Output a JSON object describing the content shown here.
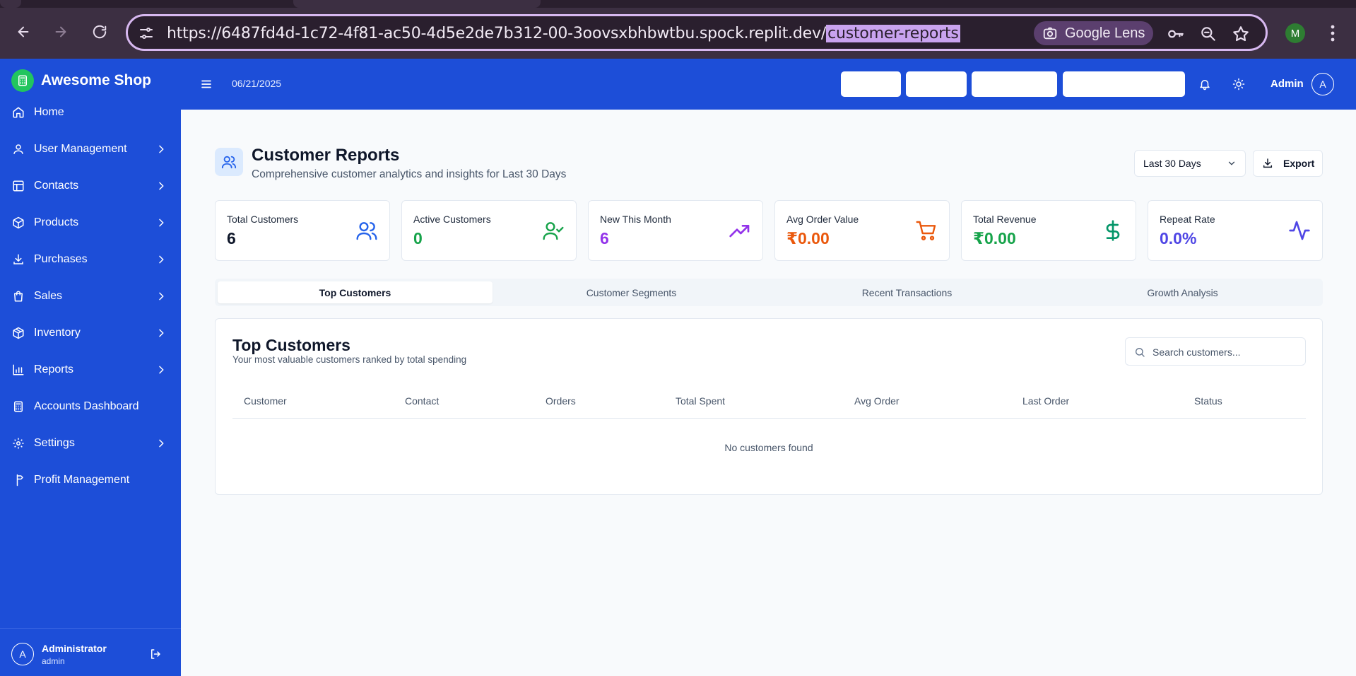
{
  "browser": {
    "url_prefix": "https://6487fd4d-1c72-4f81-ac50-4d5e2de7b312-00-3oovsxbhbwtbu.spock.replit.dev/",
    "url_highlight": "customer-reports",
    "lens_label": "Google Lens",
    "profile_initial": "M"
  },
  "sidebar": {
    "brand": "Awesome Shop",
    "items": [
      {
        "label": "Home",
        "icon": "home-icon",
        "has_children": false
      },
      {
        "label": "User Management",
        "icon": "user-icon",
        "has_children": true
      },
      {
        "label": "Contacts",
        "icon": "contacts-icon",
        "has_children": true
      },
      {
        "label": "Products",
        "icon": "box-icon",
        "has_children": true
      },
      {
        "label": "Purchases",
        "icon": "download-icon",
        "has_children": true
      },
      {
        "label": "Sales",
        "icon": "shopping-bag-icon",
        "has_children": true
      },
      {
        "label": "Inventory",
        "icon": "package-icon",
        "has_children": true
      },
      {
        "label": "Reports",
        "icon": "bar-chart-icon",
        "has_children": true
      },
      {
        "label": "Accounts Dashboard",
        "icon": "calculator-icon",
        "has_children": false
      },
      {
        "label": "Settings",
        "icon": "gear-icon",
        "has_children": true
      },
      {
        "label": "Profit Management",
        "icon": "signpost-icon",
        "has_children": false
      }
    ],
    "user": {
      "initial": "A",
      "name": "Administrator",
      "role": "admin"
    }
  },
  "header": {
    "date": "06/21/2025",
    "user_label": "Admin",
    "user_initial": "A"
  },
  "page": {
    "title": "Customer Reports",
    "subtitle": "Comprehensive customer analytics and insights for Last 30 Days",
    "range": "Last 30 Days",
    "export_label": "Export"
  },
  "stats": [
    {
      "title": "Total Customers",
      "value": "6",
      "color": "#0f172a",
      "icon": "users-icon",
      "icon_color": "#2563eb"
    },
    {
      "title": "Active Customers",
      "value": "0",
      "color": "#16a34a",
      "icon": "user-check-icon",
      "icon_color": "#16a34a"
    },
    {
      "title": "New This Month",
      "value": "6",
      "color": "#9333ea",
      "icon": "trending-up-icon",
      "icon_color": "#9333ea"
    },
    {
      "title": "Avg Order Value",
      "value": "₹0.00",
      "color": "#ea580c",
      "icon": "cart-icon",
      "icon_color": "#ea580c"
    },
    {
      "title": "Total Revenue",
      "value": "₹0.00",
      "color": "#16a34a",
      "icon": "dollar-icon",
      "icon_color": "#059669"
    },
    {
      "title": "Repeat Rate",
      "value": "0.0%",
      "color": "#4f46e5",
      "icon": "activity-icon",
      "icon_color": "#4f46e5"
    }
  ],
  "tabs": [
    "Top Customers",
    "Customer Segments",
    "Recent Transactions",
    "Growth Analysis"
  ],
  "panel": {
    "title": "Top Customers",
    "subtitle": "Your most valuable customers ranked by total spending",
    "search_placeholder": "Search customers...",
    "columns": [
      "Customer",
      "Contact",
      "Orders",
      "Total Spent",
      "Avg Order",
      "Last Order",
      "Status"
    ],
    "empty_text": "No customers found"
  }
}
